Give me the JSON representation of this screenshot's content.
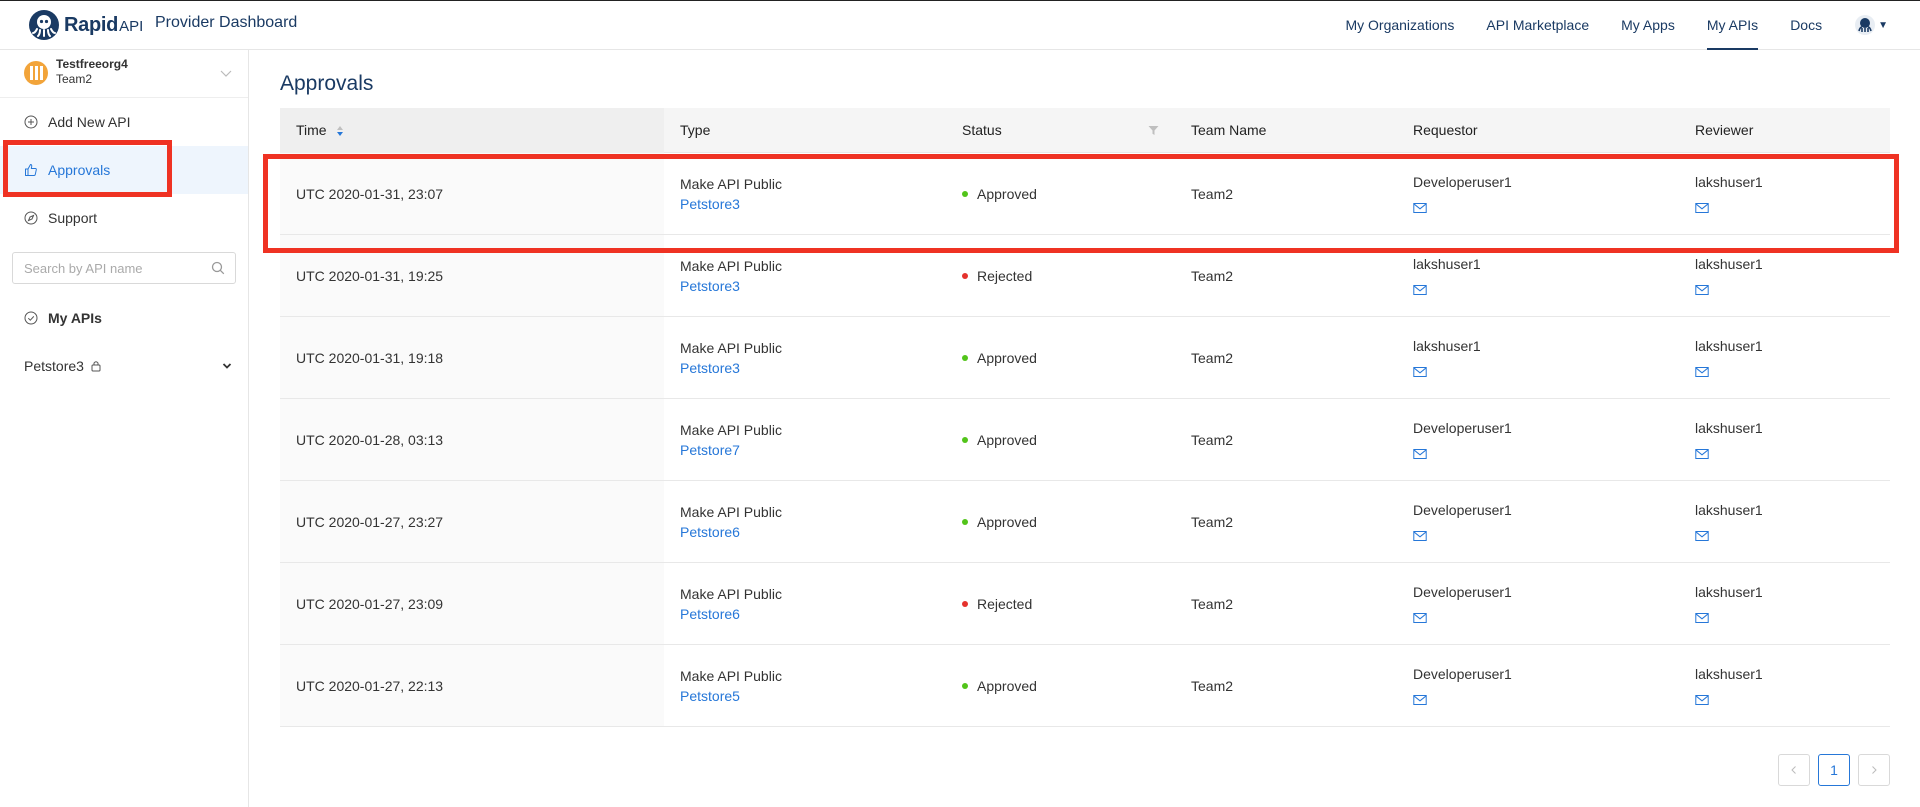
{
  "brand": {
    "logo_text": "Rapid",
    "logo_suffix": "API",
    "dashboard_title": "Provider Dashboard"
  },
  "topnav": [
    {
      "label": "My Organizations",
      "active": false
    },
    {
      "label": "API Marketplace",
      "active": false
    },
    {
      "label": "My Apps",
      "active": false
    },
    {
      "label": "My APIs",
      "active": true
    },
    {
      "label": "Docs",
      "active": false
    }
  ],
  "sidebar": {
    "org": {
      "name": "Testfreeorg4",
      "team": "Team2"
    },
    "items": [
      {
        "label": "Add New API",
        "icon": "plus-circle-icon"
      },
      {
        "label": "Approvals",
        "icon": "thumbs-up-icon",
        "active": true
      },
      {
        "label": "Support",
        "icon": "compass-icon"
      }
    ],
    "search": {
      "placeholder": "Search by API name",
      "value": ""
    },
    "my_apis_label": "My APIs",
    "apis": [
      {
        "label": "Petstore3",
        "locked": true
      }
    ]
  },
  "main": {
    "title": "Approvals",
    "columns": [
      "Time",
      "Type",
      "Status",
      "Team Name",
      "Requestor",
      "Reviewer"
    ],
    "rows": [
      {
        "time": "UTC 2020-01-31, 23:07",
        "type": "Make API Public",
        "api": "Petstore3",
        "status": "Approved",
        "team": "Team2",
        "requestor": "Developeruser1",
        "reviewer": "lakshuser1"
      },
      {
        "time": "UTC 2020-01-31, 19:25",
        "type": "Make API Public",
        "api": "Petstore3",
        "status": "Rejected",
        "team": "Team2",
        "requestor": "lakshuser1",
        "reviewer": "lakshuser1"
      },
      {
        "time": "UTC 2020-01-31, 19:18",
        "type": "Make API Public",
        "api": "Petstore3",
        "status": "Approved",
        "team": "Team2",
        "requestor": "lakshuser1",
        "reviewer": "lakshuser1"
      },
      {
        "time": "UTC 2020-01-28, 03:13",
        "type": "Make API Public",
        "api": "Petstore7",
        "status": "Approved",
        "team": "Team2",
        "requestor": "Developeruser1",
        "reviewer": "lakshuser1"
      },
      {
        "time": "UTC 2020-01-27, 23:27",
        "type": "Make API Public",
        "api": "Petstore6",
        "status": "Approved",
        "team": "Team2",
        "requestor": "Developeruser1",
        "reviewer": "lakshuser1"
      },
      {
        "time": "UTC 2020-01-27, 23:09",
        "type": "Make API Public",
        "api": "Petstore6",
        "status": "Rejected",
        "team": "Team2",
        "requestor": "Developeruser1",
        "reviewer": "lakshuser1"
      },
      {
        "time": "UTC 2020-01-27, 22:13",
        "type": "Make API Public",
        "api": "Petstore5",
        "status": "Approved",
        "team": "Team2",
        "requestor": "Developeruser1",
        "reviewer": "lakshuser1"
      }
    ],
    "pagination": {
      "current_page": "1"
    }
  },
  "colors": {
    "brand_navy": "#1a3a63",
    "link_blue": "#2677d8",
    "approved_green": "#52c41a",
    "rejected_red": "#e5322d",
    "highlight_red": "#ef3223"
  }
}
